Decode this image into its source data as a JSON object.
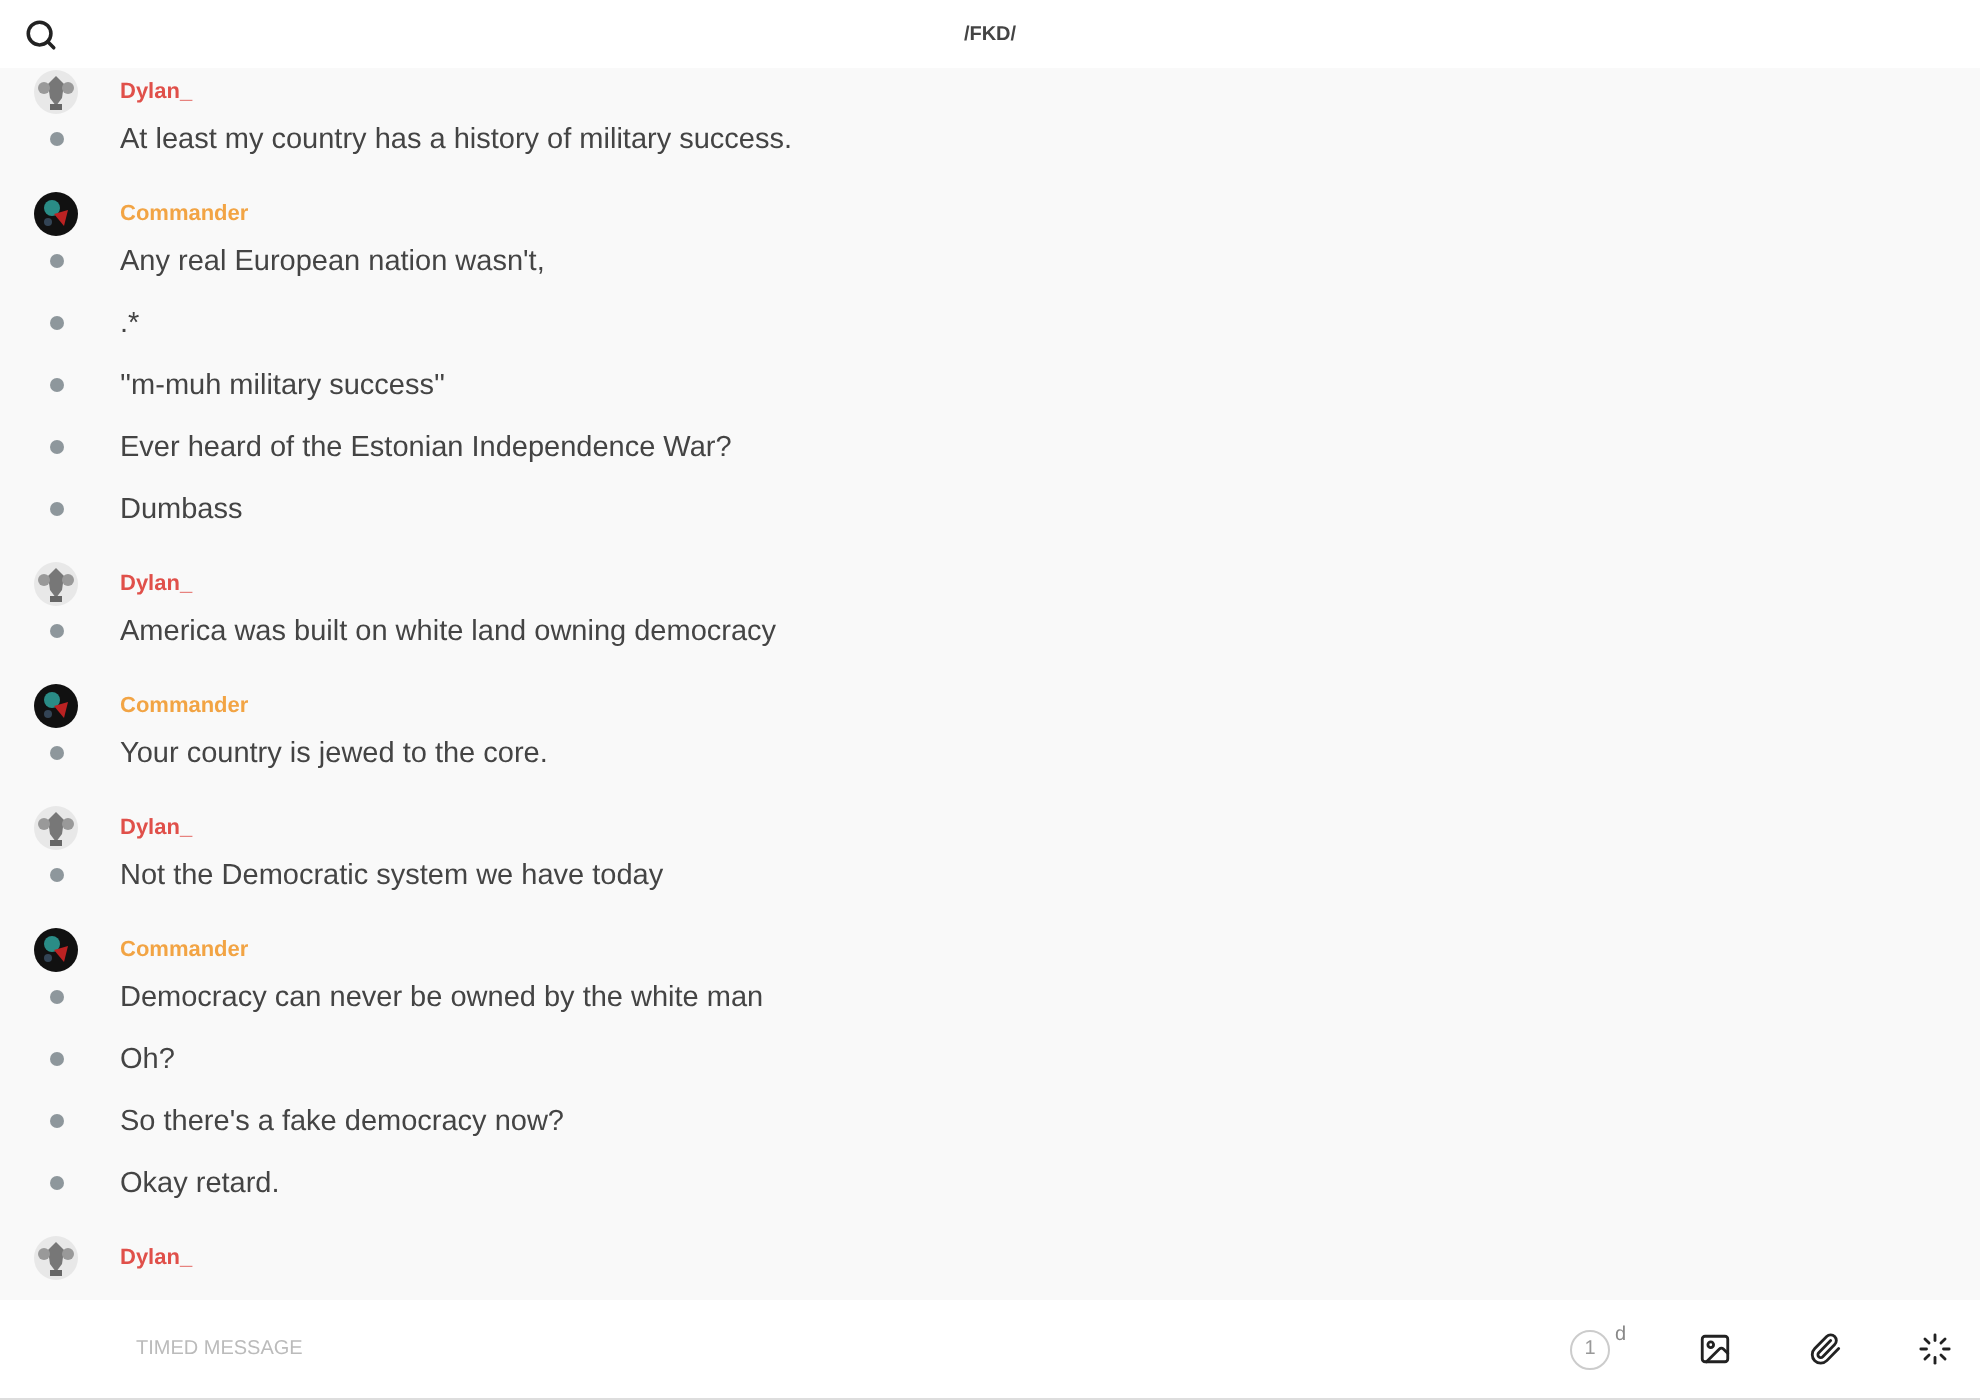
{
  "header": {
    "channel": "/FKD/"
  },
  "groups": [
    {
      "sender": "Dylan_",
      "color": "#e0504a",
      "avatar": {
        "kind": "crest"
      },
      "messages": [
        "At least my country has a history of military success."
      ]
    },
    {
      "sender": "Commander",
      "color": "#f2a444",
      "avatar": {
        "kind": "dark"
      },
      "messages": [
        "Any real European nation wasn't,",
        ".*",
        "''m-muh military success''",
        "Ever heard of the Estonian Independence War?",
        "Dumbass"
      ]
    },
    {
      "sender": "Dylan_",
      "color": "#e0504a",
      "avatar": {
        "kind": "crest"
      },
      "messages": [
        "America was built on white land owning democracy"
      ]
    },
    {
      "sender": "Commander",
      "color": "#f2a444",
      "avatar": {
        "kind": "dark"
      },
      "messages": [
        "Your country is jewed to the core."
      ]
    },
    {
      "sender": "Dylan_",
      "color": "#e0504a",
      "avatar": {
        "kind": "crest"
      },
      "messages": [
        "Not the Democratic system we have today"
      ]
    },
    {
      "sender": "Commander",
      "color": "#f2a444",
      "avatar": {
        "kind": "dark"
      },
      "messages": [
        "Democracy can never be owned by the white man",
        "Oh?",
        "So there's a fake democracy now?",
        "Okay retard."
      ]
    },
    {
      "sender": "Dylan_",
      "color": "#e0504a",
      "avatar": {
        "kind": "crest"
      }
    }
  ],
  "composer": {
    "placeholder": "TIMED MESSAGE",
    "timer": {
      "value": "1",
      "unit": "d"
    }
  }
}
